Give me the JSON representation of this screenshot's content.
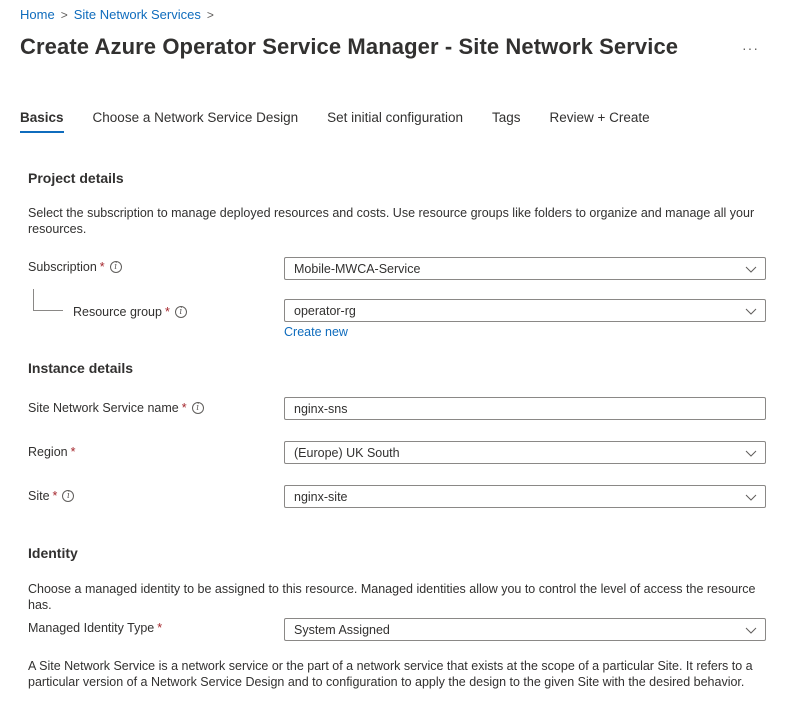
{
  "breadcrumb": {
    "home": "Home",
    "site_network_services": "Site Network Services",
    "separator": ">"
  },
  "header": {
    "title": "Create Azure Operator Service Manager - Site Network Service",
    "more": "···"
  },
  "tabs": [
    {
      "label": "Basics",
      "active": true
    },
    {
      "label": "Choose a Network Service Design",
      "active": false
    },
    {
      "label": "Set initial configuration",
      "active": false
    },
    {
      "label": "Tags",
      "active": false
    },
    {
      "label": "Review + Create",
      "active": false
    }
  ],
  "project_details": {
    "title": "Project details",
    "description": "Select the subscription to manage deployed resources and costs. Use resource groups like folders to organize and manage all your resources.",
    "subscription_label": "Subscription",
    "subscription_value": "Mobile-MWCA-Service",
    "resource_group_label": "Resource group",
    "resource_group_value": "operator-rg",
    "create_new": "Create new"
  },
  "instance_details": {
    "title": "Instance details",
    "name_label": "Site Network Service name",
    "name_value": "nginx-sns",
    "region_label": "Region",
    "region_value": "(Europe) UK South",
    "site_label": "Site",
    "site_value": "nginx-site"
  },
  "identity": {
    "title": "Identity",
    "description": "Choose a managed identity to be assigned to this resource. Managed identities allow you to control the level of access the resource has.",
    "type_label": "Managed Identity Type",
    "type_value": "System Assigned"
  },
  "footer_note": "A Site Network Service is a network service or the part of a network service that exists at the scope of a particular Site. It refers to a particular version of a Network Service Design and to configuration to apply the design to the given Site with the desired behavior.",
  "symbols": {
    "required": "*",
    "info": "i"
  },
  "colors": {
    "link": "#0f6cbd",
    "required": "#a4262c",
    "text": "#323130",
    "border": "#8a8886"
  },
  "icons": {
    "info": "info-icon",
    "chevron": "chevron-down-icon"
  }
}
